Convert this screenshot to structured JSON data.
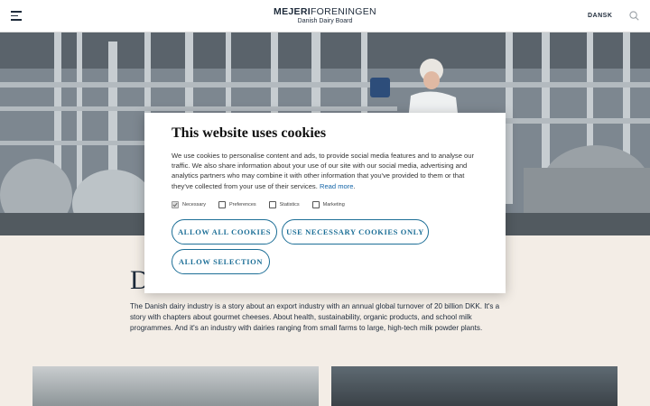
{
  "header": {
    "logo_bold": "MEJERI",
    "logo_rest": "FORENINGEN",
    "logo_sub": "Danish Dairy Board",
    "language": "DANSK",
    "menu_icon": "hamburger-menu-icon",
    "search_icon": "search-icon"
  },
  "hero": {
    "description_icon": "dairy-plant-photo"
  },
  "content": {
    "heading": "D",
    "body": "The Danish dairy industry is a story about an export industry with an annual global turnover of 20 billion DKK. It's a story with chapters about gourmet cheeses. About health, sustainability, organic products, and school milk programmes. And it's an industry with dairies ranging from small farms to large, high-tech milk powder plants."
  },
  "cookie_dialog": {
    "title": "This website uses cookies",
    "body": "We use cookies to personalise content and ads, to provide social media features and to analyse our traffic. We also share information about your use of our site with our social media, advertising and analytics partners who may combine it with other information that you've provided to them or that they've collected from your use of their services.",
    "read_more": "Read more",
    "checkboxes": [
      {
        "label": "Necessary",
        "checked": true
      },
      {
        "label": "Preferences",
        "checked": false
      },
      {
        "label": "Statistics",
        "checked": false
      },
      {
        "label": "Marketing",
        "checked": false
      }
    ],
    "buttons": {
      "allow_all": "ALLOW ALL COOKIES",
      "necessary_only": "USE NECESSARY COOKIES ONLY",
      "allow_selection": "ALLOW SELECTION"
    }
  },
  "colors": {
    "accent": "#1d6f97",
    "link": "#1565a8",
    "page_background": "#f3ede6",
    "text_dark": "#1d2a3a"
  }
}
